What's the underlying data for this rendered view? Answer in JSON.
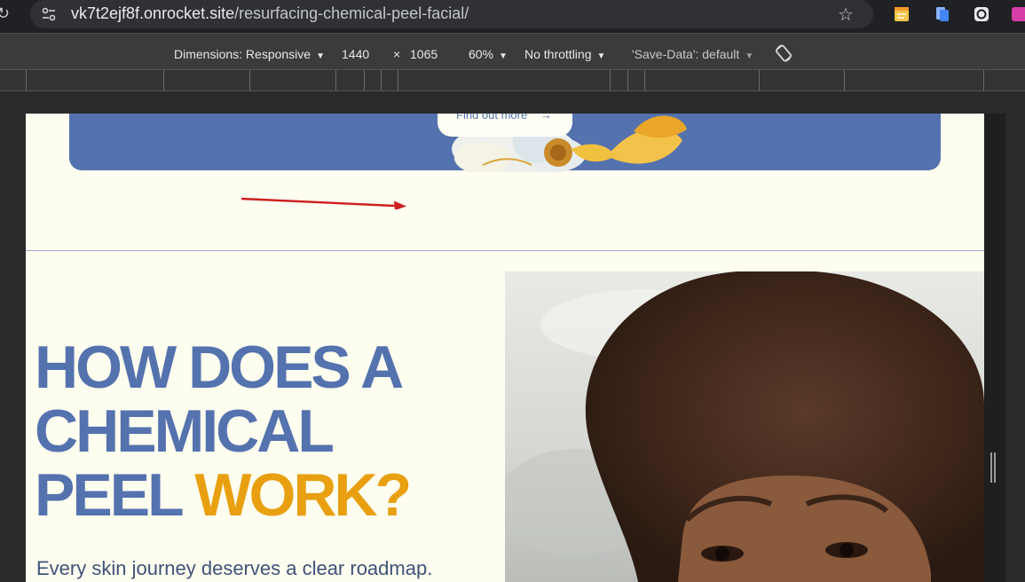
{
  "browser": {
    "url_host": "vk7t2ejf8f.onrocket.site",
    "url_path": "/resurfacing-chemical-peel-facial/"
  },
  "devtools": {
    "dimensions": "Dimensions: Responsive",
    "width": "1440",
    "times": "×",
    "height": "1065",
    "zoom": "60%",
    "throttling": "No throttling",
    "save_data": "'Save-Data': default"
  },
  "page": {
    "banner_button": "Find out more",
    "banner_button_arrow": "→",
    "headline_line1": "HOW DOES A",
    "headline_line2": "CHEMICAL",
    "headline_line3_a": "PEEL ",
    "headline_line3_b": "WORK?",
    "subtext": "Every skin journey deserves a clear roadmap."
  },
  "colors": {
    "page_bg": "#fdfdf0",
    "brand_blue": "#5472ae",
    "accent_orange": "#e8a010",
    "annotation_red": "#cc1f1f"
  },
  "icons": [
    "reload-icon",
    "tune-icon",
    "star-icon",
    "extension-icons",
    "rotate-icon",
    "flower-image",
    "portrait-photo"
  ]
}
